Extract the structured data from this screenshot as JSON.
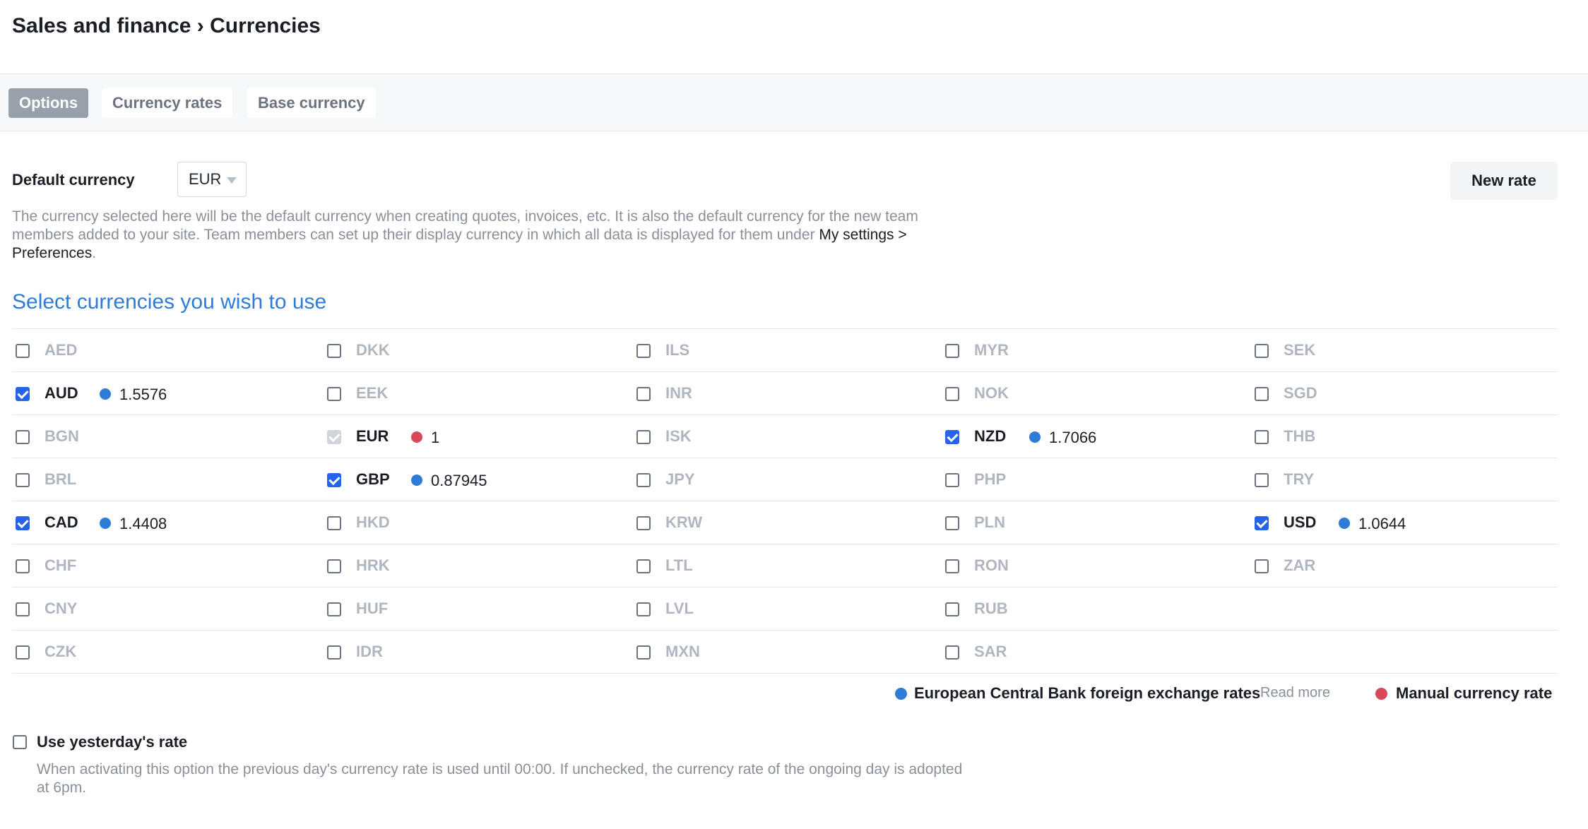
{
  "header": {
    "title": "Sales and finance › Currencies"
  },
  "tabs": [
    {
      "label": "Options",
      "active": true
    },
    {
      "label": "Currency rates",
      "active": false
    },
    {
      "label": "Base currency",
      "active": false
    }
  ],
  "default_currency": {
    "label": "Default currency",
    "selected": "EUR",
    "new_rate_label": "New rate",
    "help_text": "The currency selected here will be the default currency when creating quotes, invoices, etc. It is also the default currency for the new team members added to your site. Team members can set up their display currency in which all data is displayed for them under ",
    "help_link": "My settings > Preferences",
    "help_suffix": "."
  },
  "section_title": "Select currencies you wish to use",
  "colors": {
    "ecb": "#2f7bd8",
    "manual": "#d8485a",
    "accent": "#2f7bd8",
    "checkbox": "#2563eb"
  },
  "currency_columns": [
    [
      {
        "code": "AED",
        "checked": false
      },
      {
        "code": "AUD",
        "checked": true,
        "rate": "1.5576",
        "source": "ecb"
      },
      {
        "code": "BGN",
        "checked": false
      },
      {
        "code": "BRL",
        "checked": false
      },
      {
        "code": "CAD",
        "checked": true,
        "rate": "1.4408",
        "source": "ecb"
      },
      {
        "code": "CHF",
        "checked": false
      },
      {
        "code": "CNY",
        "checked": false
      },
      {
        "code": "CZK",
        "checked": false
      }
    ],
    [
      {
        "code": "DKK",
        "checked": false
      },
      {
        "code": "EEK",
        "checked": false
      },
      {
        "code": "EUR",
        "checked": true,
        "disabled": true,
        "rate": "1",
        "source": "manual"
      },
      {
        "code": "GBP",
        "checked": true,
        "rate": "0.87945",
        "source": "ecb"
      },
      {
        "code": "HKD",
        "checked": false
      },
      {
        "code": "HRK",
        "checked": false
      },
      {
        "code": "HUF",
        "checked": false
      },
      {
        "code": "IDR",
        "checked": false
      }
    ],
    [
      {
        "code": "ILS",
        "checked": false
      },
      {
        "code": "INR",
        "checked": false
      },
      {
        "code": "ISK",
        "checked": false
      },
      {
        "code": "JPY",
        "checked": false
      },
      {
        "code": "KRW",
        "checked": false
      },
      {
        "code": "LTL",
        "checked": false
      },
      {
        "code": "LVL",
        "checked": false
      },
      {
        "code": "MXN",
        "checked": false
      }
    ],
    [
      {
        "code": "MYR",
        "checked": false
      },
      {
        "code": "NOK",
        "checked": false
      },
      {
        "code": "NZD",
        "checked": true,
        "rate": "1.7066",
        "source": "ecb"
      },
      {
        "code": "PHP",
        "checked": false
      },
      {
        "code": "PLN",
        "checked": false
      },
      {
        "code": "RON",
        "checked": false
      },
      {
        "code": "RUB",
        "checked": false
      },
      {
        "code": "SAR",
        "checked": false
      }
    ],
    [
      {
        "code": "SEK",
        "checked": false
      },
      {
        "code": "SGD",
        "checked": false
      },
      {
        "code": "THB",
        "checked": false
      },
      {
        "code": "TRY",
        "checked": false
      },
      {
        "code": "USD",
        "checked": true,
        "rate": "1.0644",
        "source": "ecb"
      },
      {
        "code": "ZAR",
        "checked": false
      }
    ]
  ],
  "legend": {
    "ecb_label": "European Central Bank foreign exchange rates",
    "read_more": "Read more",
    "manual_label": "Manual currency rate"
  },
  "yesterday": {
    "label": "Use yesterday's rate",
    "checked": false,
    "description": "When activating this option the previous day's currency rate is used until 00:00. If unchecked, the currency rate of the ongoing day is adopted at 6pm."
  }
}
